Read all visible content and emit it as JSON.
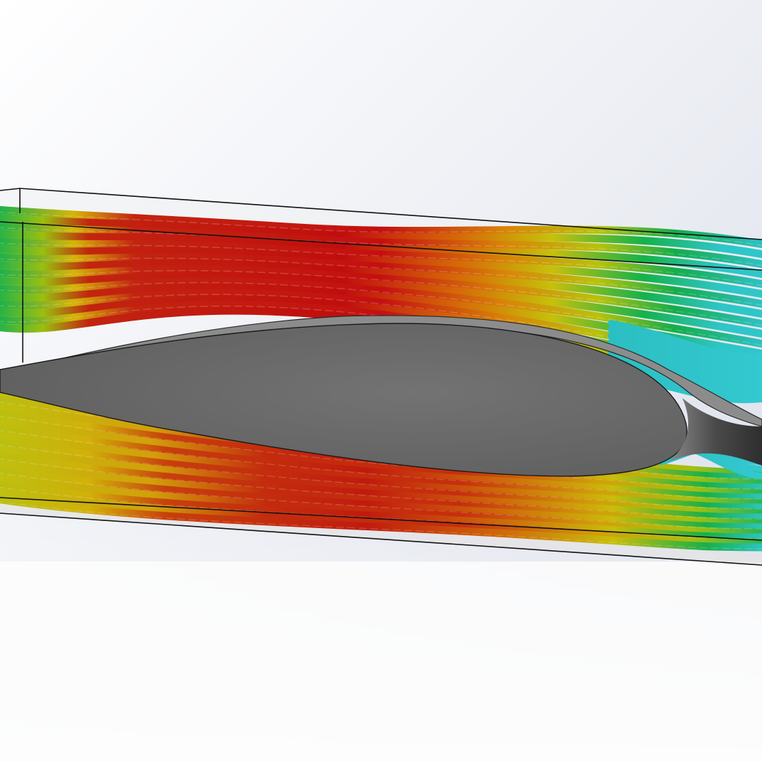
{
  "viewport": {
    "background_top": "#dfe3ec",
    "background_bottom": "#ffffff"
  },
  "scene": {
    "airfoil_color": "#6b6b6b",
    "domain_edge_color": "#111111",
    "flow_trajectory_palette": [
      "#2fc6c9",
      "#15b24a",
      "#9bbf0f",
      "#d6b408",
      "#d86a08",
      "#c00e0e"
    ]
  },
  "icons": {
    "airfoil": "airfoil-body",
    "domain": "computational-domain-box",
    "streamlines": "flow-trajectories"
  }
}
